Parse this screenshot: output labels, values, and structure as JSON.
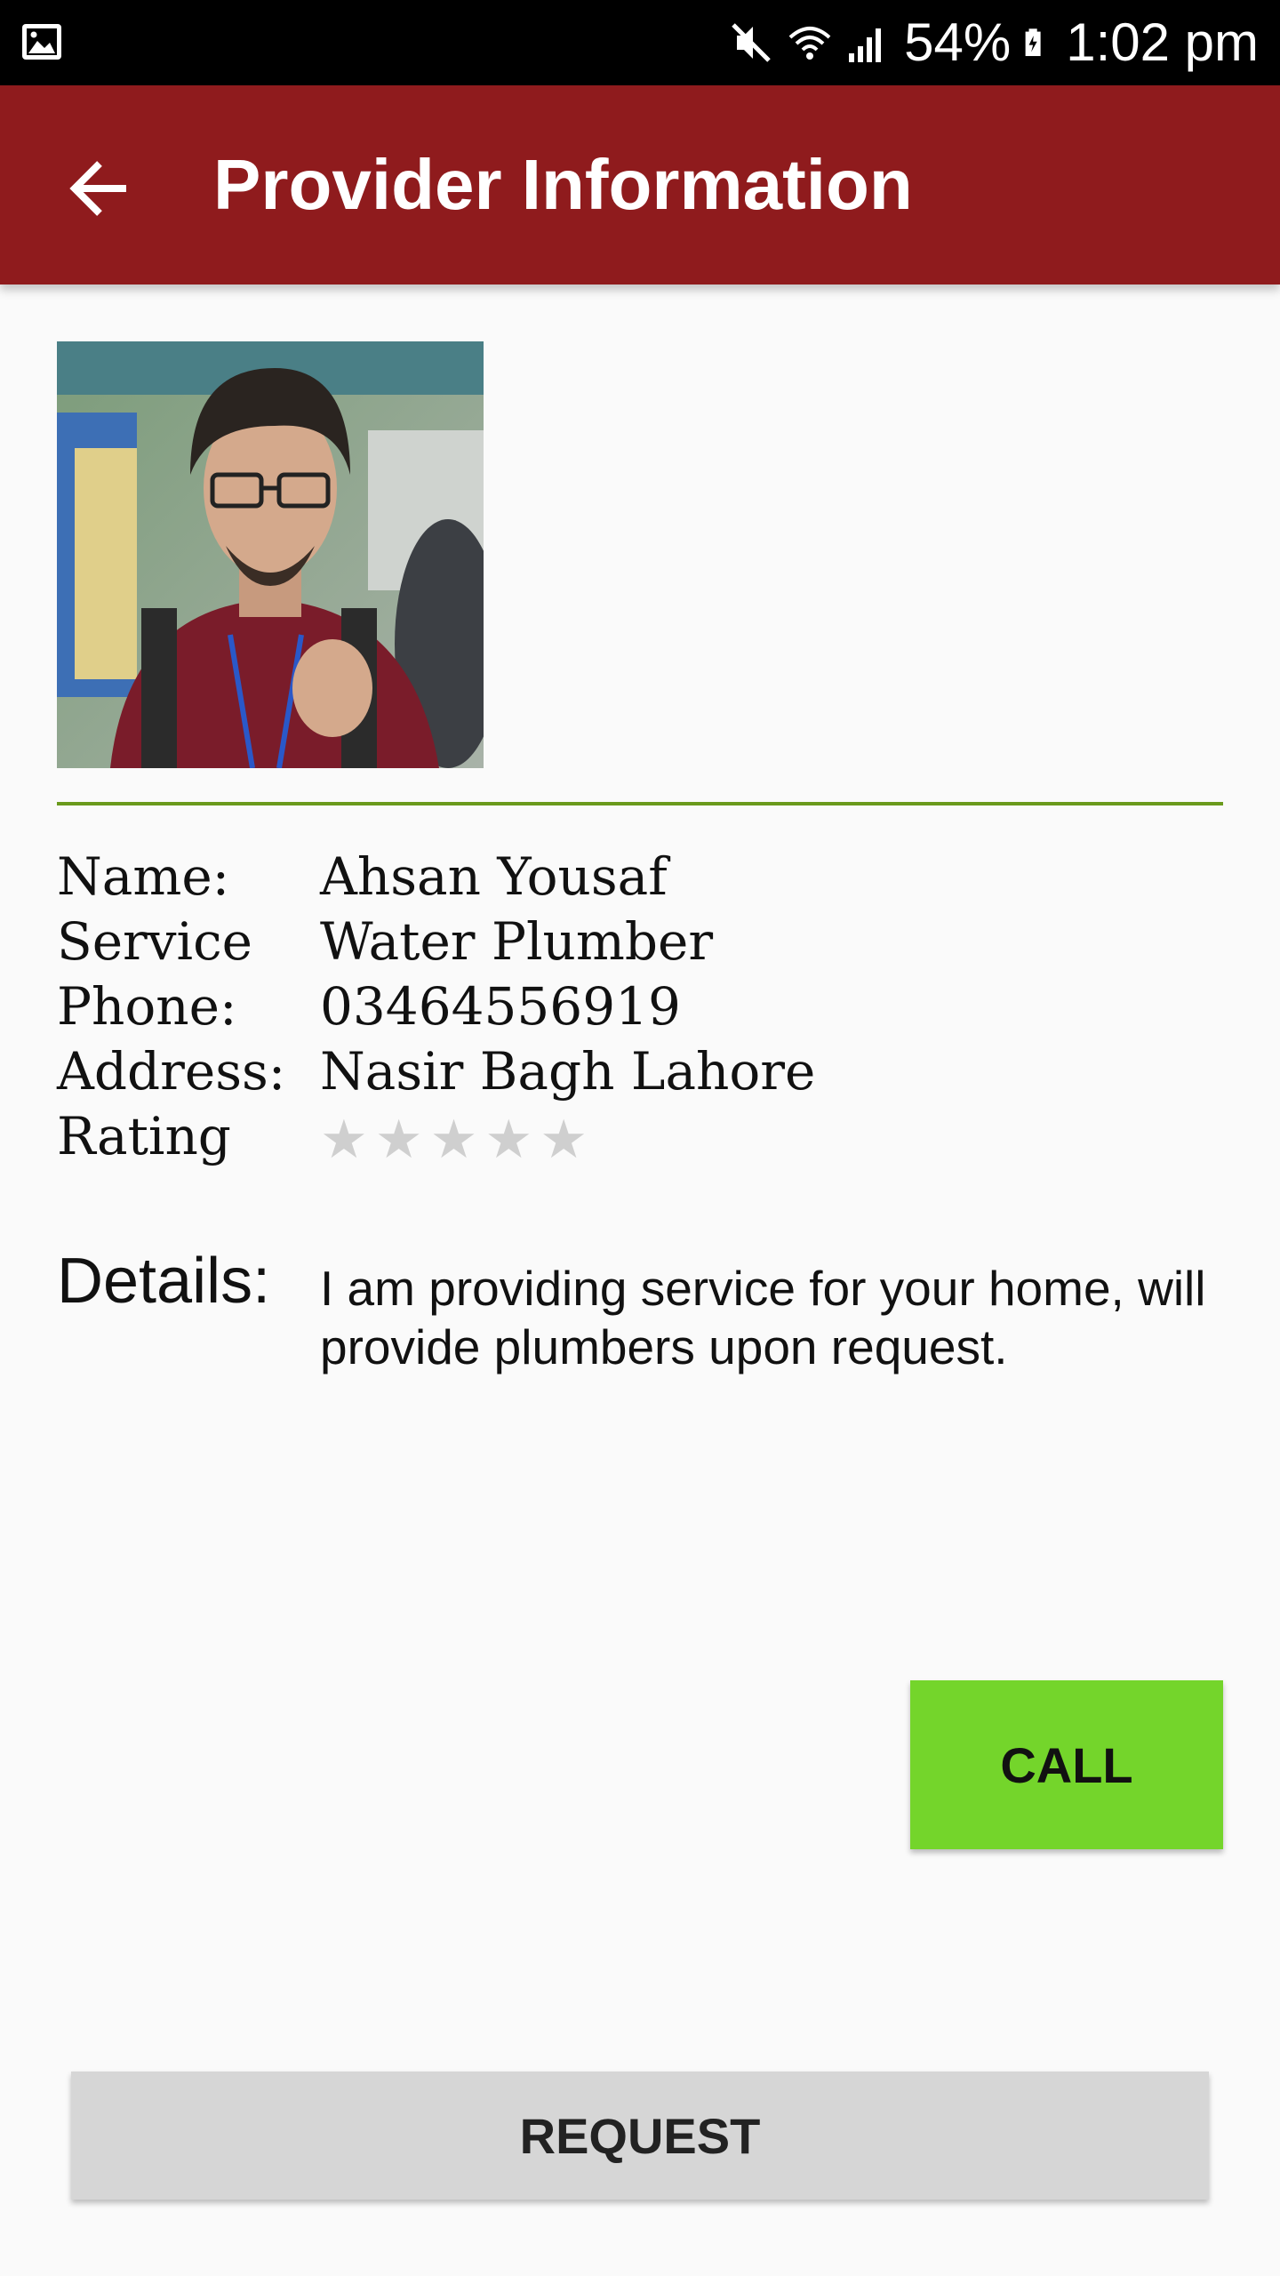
{
  "status_bar": {
    "battery": "54%",
    "time": "1:02 pm",
    "icons": [
      "gallery-icon",
      "mute-icon",
      "wifi-icon",
      "signal-icon",
      "battery-icon"
    ]
  },
  "header": {
    "title": "Provider Information",
    "back_icon": "arrow-back-icon",
    "bar_color": "#8f1b1d"
  },
  "profile": {
    "photo": "provider-photo",
    "fields": [
      {
        "label": "Name:",
        "value": "Ahsan Yousaf"
      },
      {
        "label": "Service",
        "value": "Water Plumber"
      },
      {
        "label": "Phone:",
        "value": "03464556919"
      },
      {
        "label": "Address:",
        "value": "Nasir Bagh Lahore"
      },
      {
        "label": "Rating",
        "value": ""
      }
    ],
    "rating": {
      "value": 0,
      "max": 5
    }
  },
  "details": {
    "label": "Details:",
    "text": "I am providing service for your home, will provide plumbers upon request."
  },
  "actions": {
    "call_label": "CALL",
    "call_color": "#74d52b",
    "request_label": "REQUEST",
    "request_color": "#d6d6d6"
  }
}
